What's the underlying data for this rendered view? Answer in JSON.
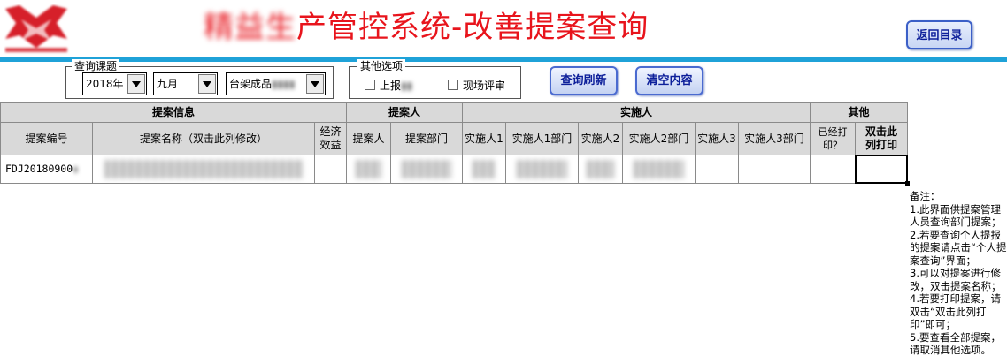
{
  "header": {
    "title_head": "精益生",
    "title_tail": "产管控系统-改善提案查询",
    "return_label": "返回目录"
  },
  "filters": {
    "query_group_label": "查询课题",
    "year": "2018年",
    "month": "九月",
    "category": "台架成品",
    "other_group_label": "其他选项",
    "opt_reported": "上报",
    "opt_onsite": "现场评审",
    "refresh_label": "查询刷新",
    "clear_label": "清空内容"
  },
  "table": {
    "groups": {
      "proposal_info": "提案信息",
      "proposer": "提案人",
      "implementer": "实施人",
      "other": "其他"
    },
    "columns": {
      "id": "提案编号",
      "name": "提案名称（双击此列修改）",
      "benefit": "经济效益",
      "proposer": "提案人",
      "proposer_dept": "提案部门",
      "impl1": "实施人1",
      "impl1_dept": "实施人1部门",
      "impl2": "实施人2",
      "impl2_dept": "实施人2部门",
      "impl3": "实施人3",
      "impl3_dept": "实施人3部门",
      "printed": "已经打印？",
      "print": "双击此列打印"
    },
    "rows": [
      {
        "id": "FDJ20180900"
      }
    ]
  },
  "notes": {
    "title": "备注：",
    "items": [
      "1.此界面供提案管理人员查询部门提案；",
      "2.若要查询个人提报的提案请点击“个人提案查询”界面；",
      "3.可以对提案进行修改，双击提案名称；",
      "4.若要打印提案，请双击“双击此列打印”即可；",
      "5.要查看全部提案，请取消其他选项。"
    ]
  },
  "colors": {
    "title_red": "#e8141c",
    "accent_line": "#1fa2d8",
    "button_text": "#0d1f9a",
    "header_fill": "#d9d9d9"
  }
}
